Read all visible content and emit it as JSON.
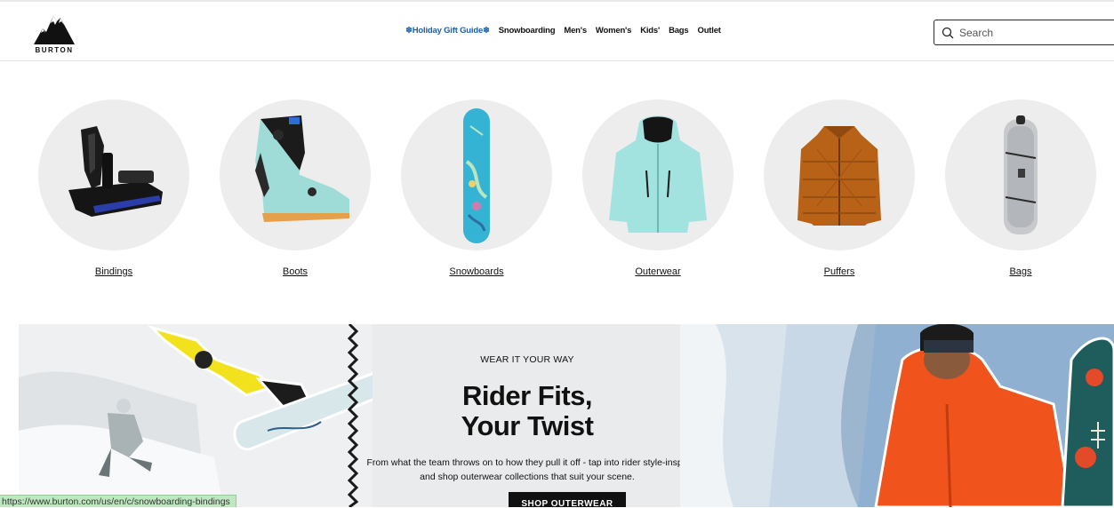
{
  "brand": {
    "logo_text": "BURTON"
  },
  "nav": {
    "items": [
      {
        "label": "❄Holiday Gift Guide❄",
        "accent": "#1a5fa8"
      },
      {
        "label": "Snowboarding"
      },
      {
        "label": "Men's"
      },
      {
        "label": "Women's"
      },
      {
        "label": "Kids'"
      },
      {
        "label": "Bags"
      },
      {
        "label": "Outlet"
      }
    ]
  },
  "search": {
    "placeholder": "Search",
    "icon": "search-icon"
  },
  "categories": [
    {
      "label": "Bindings",
      "icon": "binding-image"
    },
    {
      "label": "Boots",
      "icon": "boot-image"
    },
    {
      "label": "Snowboards",
      "icon": "snowboard-image"
    },
    {
      "label": "Outerwear",
      "icon": "jacket-image"
    },
    {
      "label": "Puffers",
      "icon": "puffer-image"
    },
    {
      "label": "Bags",
      "icon": "board-bag-image"
    }
  ],
  "promo": {
    "kicker": "WEAR IT YOUR WAY",
    "headline_line1": "Rider Fits,",
    "headline_line2": "Your Twist",
    "body": "From what the team throws on to how they pull it off - tap into rider style-inspo and shop outerwear collections that suit your scene.",
    "cta_label": "SHOP OUTERWEAR"
  },
  "status_bar": {
    "url": "https://www.burton.com/us/en/c/snowboarding-bindings"
  },
  "colors": {
    "accent": "#1a5fa8",
    "circle_bg": "#ededed",
    "cta_bg": "#111111"
  }
}
